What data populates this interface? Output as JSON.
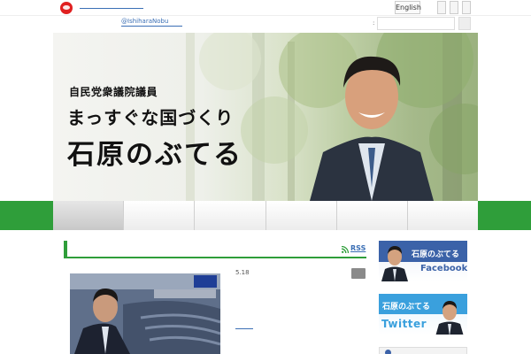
{
  "header": {
    "language_button": "English",
    "twitter_handle": "@IshiharaNobu"
  },
  "hero": {
    "subtitle": "自民党衆議院議員",
    "slogan": "まっすぐな国づくり",
    "name": "石原のぶてる"
  },
  "nav": {
    "items": [
      "",
      "",
      "",
      "",
      "",
      ""
    ],
    "active_index": 0
  },
  "main": {
    "rss_label": "RSS",
    "post": {
      "date": "5.18"
    }
  },
  "sidebar": {
    "facebook_banner": {
      "title": "石原のぶてる",
      "service": "Facebook"
    },
    "twitter_banner": {
      "title": "石原のぶてる",
      "service": "Twitter"
    }
  },
  "colors": {
    "nav_green": "#2f9e3a",
    "link_blue": "#3b6fb5",
    "facebook_blue": "#3b62a8",
    "twitter_blue": "#3aa0dd"
  },
  "icons": [
    "site-logo-icon",
    "rss-icon",
    "search-icon"
  ]
}
